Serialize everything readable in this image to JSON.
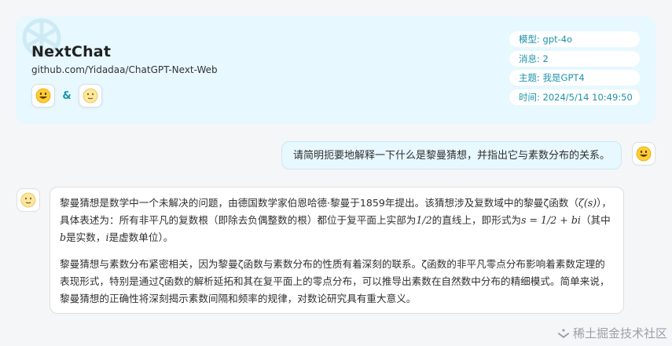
{
  "header": {
    "title": "NextChat",
    "subtitle": "github.com/Yidadaa/ChatGPT-Next-Web",
    "avatar_separator": "&"
  },
  "meta": {
    "model": "模型: gpt-4o",
    "messages": "消息: 2",
    "topic": "主题: 我是GPT4",
    "time": "时间: 2024/5/14 10:49:50"
  },
  "user_message": "请简明扼要地解释一下什么是黎曼猜想，并指出它与素数分布的关系。",
  "bot_message": {
    "p1_a": "黎曼猜想是数学中一个未解决的问题，由德国数学家伯恩哈德·黎曼于1859年提出。该猜想涉及复数域中的黎曼ζ函数（",
    "p1_zeta": "ζ(s)",
    "p1_b": "），具体表述为：所有非平凡的复数根（即除去负偶整数的根）都位于复平面上实部为",
    "p1_half": "1/2",
    "p1_c": "的直线上，即形式为",
    "p1_formula": "s = 1/2 + bi",
    "p1_d": "（其中",
    "p1_b_var": "b",
    "p1_e": "是实数，",
    "p1_i_var": "i",
    "p1_f": "是虚数单位）。",
    "p2": "黎曼猜想与素数分布紧密相关，因为黎曼ζ函数与素数分布的性质有着深刻的联系。ζ函数的非平凡零点分布影响着素数定理的表现形式，特别是通过ζ函数的解析延拓和其在复平面上的零点分布，可以推导出素数在自然数中分布的精细模式。简单来说，黎曼猜想的正确性将深刻揭示素数间隔和频率的规律，对数论研究具有重大意义。"
  },
  "watermark": "稀土掘金技术社区"
}
